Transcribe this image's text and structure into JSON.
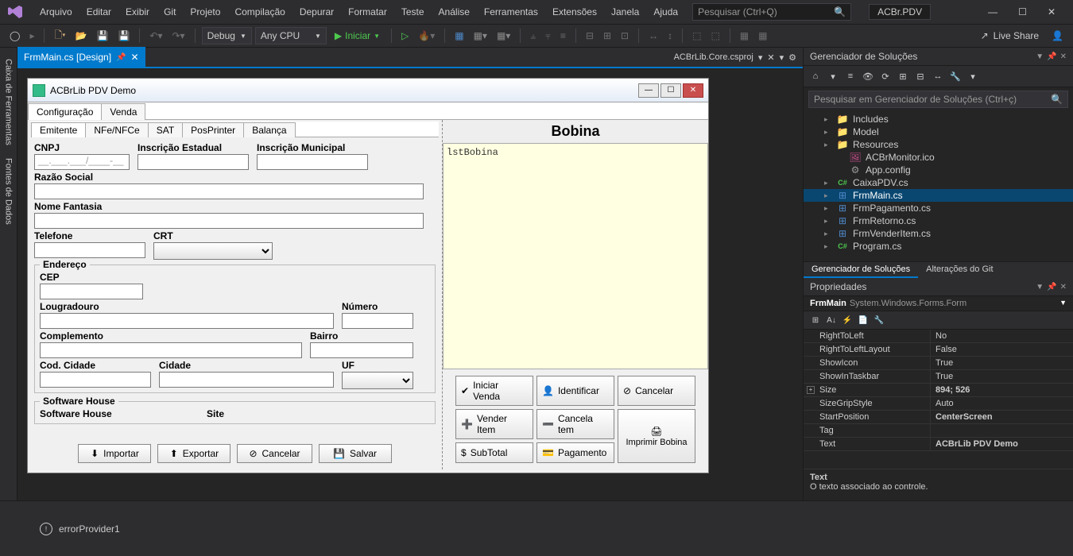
{
  "menubar": [
    "Arquivo",
    "Editar",
    "Exibir",
    "Git",
    "Projeto",
    "Compilação",
    "Depurar",
    "Formatar",
    "Teste",
    "Análise",
    "Ferramentas",
    "Extensões",
    "Janela",
    "Ajuda"
  ],
  "search_placeholder": "Pesquisar (Ctrl+Q)",
  "project_name": "ACBr.PDV",
  "toolbar": {
    "config": "Debug",
    "platform": "Any CPU",
    "start": "Iniciar",
    "liveshare": "Live Share"
  },
  "left_tabs": [
    "Caixa de Ferramentas",
    "Fontes de Dados"
  ],
  "doc": {
    "tab": "FrmMain.cs [Design]",
    "right_label": "ACBrLib.Core.csproj"
  },
  "winform": {
    "title": "ACBrLib PDV Demo",
    "tabs": [
      "Configuração",
      "Venda"
    ],
    "subtabs": [
      "Emitente",
      "NFe/NFCe",
      "SAT",
      "PosPrinter",
      "Balança"
    ],
    "labels": {
      "cnpj": "CNPJ",
      "cnpj_mask": "__.___.___/____-__",
      "ie": "Inscrição Estadual",
      "im": "Inscrição Municipal",
      "razao": "Razão Social",
      "fantasia": "Nome Fantasia",
      "telefone": "Telefone",
      "crt": "CRT",
      "endereco": "Endereço",
      "cep": "CEP",
      "logradouro": "Lougradouro",
      "numero": "Número",
      "complemento": "Complemento",
      "bairro": "Bairro",
      "codcidade": "Cod. Cidade",
      "cidade": "Cidade",
      "uf": "UF",
      "software": "Software House",
      "swhouse": "Software House",
      "site": "Site"
    },
    "buttons": {
      "importar": "Importar",
      "exportar": "Exportar",
      "cancelar": "Cancelar",
      "salvar": "Salvar"
    },
    "bobina_title": "Bobina",
    "bobina_item": "lstBobina",
    "actions": {
      "iniciar": "Iniciar Venda",
      "identificar": "Identificar",
      "cancelar": "Cancelar",
      "vender": "Vender Item",
      "cancelaitem": "Cancela tem",
      "imprimir": "Imprimir Bobina",
      "subtotal": "SubTotal",
      "pagamento": "Pagamento"
    }
  },
  "sln": {
    "title": "Gerenciador de Soluções",
    "search": "Pesquisar em Gerenciador de Soluções (Ctrl+ç)",
    "items": [
      {
        "icon": "folder",
        "label": "Includes",
        "tw": "▸"
      },
      {
        "icon": "folder",
        "label": "Model",
        "tw": "▸"
      },
      {
        "icon": "folder",
        "label": "Resources",
        "tw": "▸"
      },
      {
        "icon": "ico",
        "label": "ACBrMonitor.ico",
        "indent": 1
      },
      {
        "icon": "cfg",
        "label": "App.config",
        "indent": 1
      },
      {
        "icon": "cs",
        "label": "CaixaPDV.cs",
        "tw": "▸"
      },
      {
        "icon": "form",
        "label": "FrmMain.cs",
        "tw": "▸",
        "selected": true
      },
      {
        "icon": "form",
        "label": "FrmPagamento.cs",
        "tw": "▸"
      },
      {
        "icon": "form",
        "label": "FrmRetorno.cs",
        "tw": "▸"
      },
      {
        "icon": "form",
        "label": "FrmVenderItem.cs",
        "tw": "▸"
      },
      {
        "icon": "cs",
        "label": "Program.cs",
        "tw": "▸"
      }
    ],
    "bottom_tabs": [
      "Gerenciador de Soluções",
      "Alterações do Git"
    ]
  },
  "props": {
    "title": "Propriedades",
    "object": "FrmMain",
    "class": "System.Windows.Forms.Form",
    "rows": [
      {
        "name": "RightToLeft",
        "val": "No"
      },
      {
        "name": "RightToLeftLayout",
        "val": "False"
      },
      {
        "name": "ShowIcon",
        "val": "True"
      },
      {
        "name": "ShowInTaskbar",
        "val": "True"
      },
      {
        "name": "Size",
        "val": "894; 526",
        "bold": true,
        "exp": "+"
      },
      {
        "name": "SizeGripStyle",
        "val": "Auto"
      },
      {
        "name": "StartPosition",
        "val": "CenterScreen",
        "bold": true
      },
      {
        "name": "Tag",
        "val": ""
      },
      {
        "name": "Text",
        "val": "ACBrLib PDV Demo",
        "bold": true
      }
    ],
    "desc_title": "Text",
    "desc_body": "O texto associado ao controle."
  },
  "tray": {
    "item": "errorProvider1"
  }
}
